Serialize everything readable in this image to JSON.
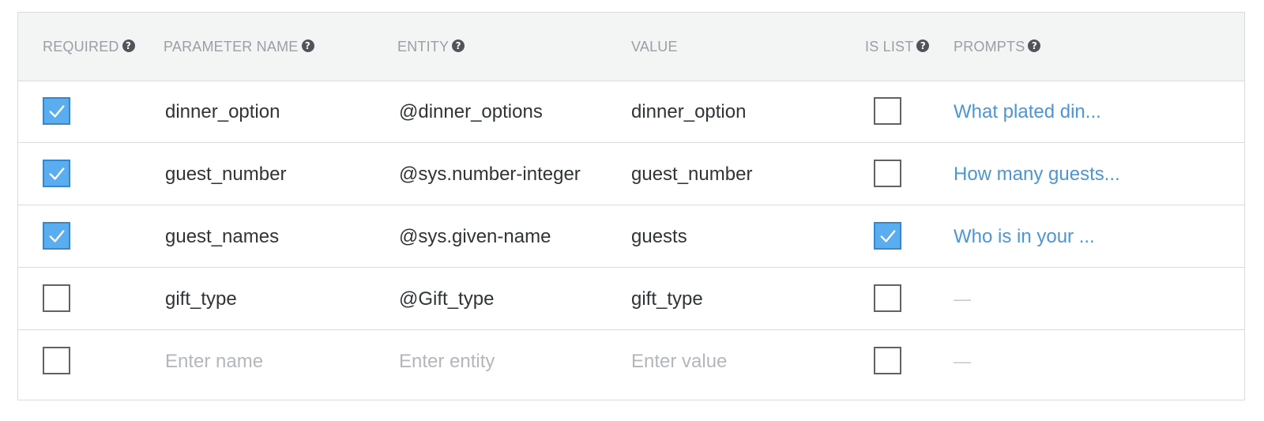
{
  "columns": {
    "required": "REQUIRED",
    "parameter_name": "PARAMETER NAME",
    "entity": "ENTITY",
    "value": "VALUE",
    "is_list": "IS LIST",
    "prompts": "PROMPTS"
  },
  "rows": [
    {
      "required": true,
      "name": "dinner_option",
      "entity": "@dinner_options",
      "value": "dinner_option",
      "is_list": false,
      "prompt": "What plated din..."
    },
    {
      "required": true,
      "name": "guest_number",
      "entity": "@sys.number-integer",
      "value": "guest_number",
      "is_list": false,
      "prompt": "How many guests..."
    },
    {
      "required": true,
      "name": "guest_names",
      "entity": "@sys.given-name",
      "value": "guests",
      "is_list": true,
      "prompt": "Who is in your ..."
    },
    {
      "required": false,
      "name": "gift_type",
      "entity": "@Gift_type",
      "value": "gift_type",
      "is_list": false,
      "prompt": "—"
    }
  ],
  "new_row": {
    "required": false,
    "name_placeholder": "Enter name",
    "entity_placeholder": "Enter entity",
    "value_placeholder": "Enter value",
    "is_list": false,
    "prompt": "—"
  },
  "colors": {
    "checked_fill": "#5aaef0",
    "prompt_link": "#4a96d6",
    "header_bg": "#f3f4f4"
  },
  "icons": {
    "help": "question-circle-icon",
    "check": "checkmark-icon"
  }
}
